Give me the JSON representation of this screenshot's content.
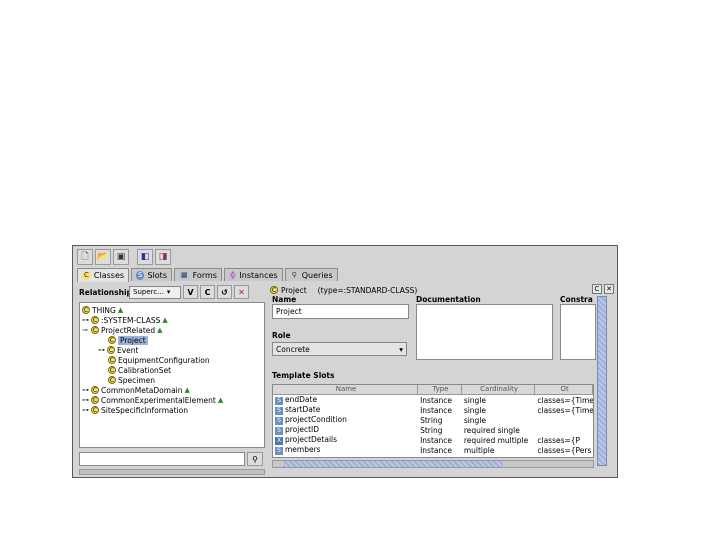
{
  "toolbar": {
    "icons": [
      "new-file-icon",
      "open-file-icon",
      "save-icon",
      "window-icon",
      "cascade-icon"
    ]
  },
  "tabs": [
    {
      "icon": "C",
      "label": "Classes",
      "active": true
    },
    {
      "icon": "S",
      "label": "Slots",
      "active": false
    },
    {
      "icon": "▦",
      "label": "Forms",
      "active": false
    },
    {
      "icon": "◊",
      "label": "Instances",
      "active": false
    },
    {
      "icon": "⚲",
      "label": "Queries",
      "active": false
    }
  ],
  "left": {
    "relationship_label": "Relationship",
    "dropdown_value": "Superc...",
    "btn_v": "V",
    "btn_c": "C",
    "tree": [
      {
        "toggle": "",
        "text": "THING"
      },
      {
        "toggle": "⊶",
        "text": ":SYSTEM-CLASS"
      },
      {
        "toggle": "⊸",
        "text": "ProjectRelated"
      },
      {
        "toggle": "",
        "text": "Project",
        "selected": true
      },
      {
        "toggle": "⊶",
        "text": "Event"
      },
      {
        "toggle": "",
        "text": "EquipmentConfiguration"
      },
      {
        "toggle": "",
        "text": "CalibrationSet"
      },
      {
        "toggle": "",
        "text": "Specimen"
      },
      {
        "toggle": "⊶",
        "text": "CommonMetaDomain"
      },
      {
        "toggle": "⊶",
        "text": "CommonExperimentalElement"
      },
      {
        "toggle": "⊶",
        "text": "SiteSpecificInformation"
      }
    ]
  },
  "right": {
    "header_name": "Project",
    "header_type": "(type=:STANDARD-CLASS)",
    "name_label": "Name",
    "name_value": "Project",
    "doc_label": "Documentation",
    "constraints_label": "Constra",
    "role_label": "Role",
    "role_value": "Concrete",
    "template_label": "Template Slots",
    "columns": [
      "Name",
      "Type",
      "Cardinality",
      "Ot"
    ],
    "slots": [
      {
        "name": "endDate",
        "type": "Instance",
        "card": "single",
        "other": "classes={Time"
      },
      {
        "name": "startDate",
        "type": "Instance",
        "card": "single",
        "other": "classes={Time"
      },
      {
        "name": "projectCondition",
        "type": "String",
        "card": "single",
        "other": ""
      },
      {
        "name": "projectID",
        "type": "String",
        "card": "required single",
        "other": ""
      },
      {
        "name": "projectDetails",
        "type": "Instance",
        "card": "required multiple",
        "other": "classes={P"
      },
      {
        "name": "members",
        "type": "Instance",
        "card": "multiple",
        "other": "classes={Pers"
      }
    ]
  }
}
